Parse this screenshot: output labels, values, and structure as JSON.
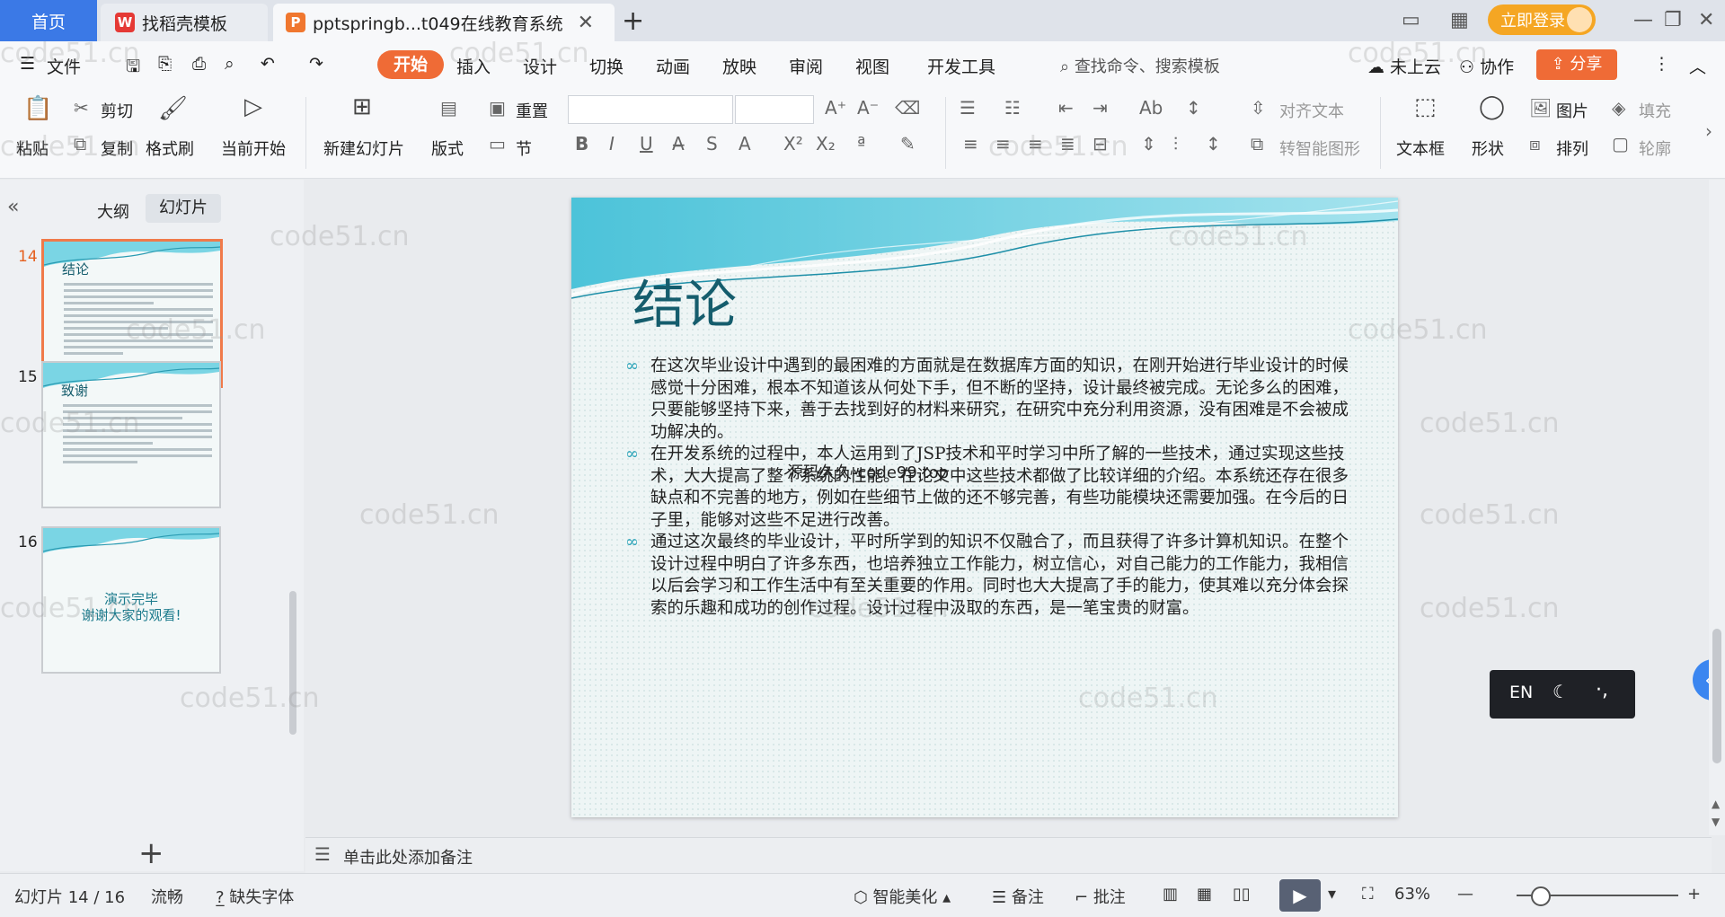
{
  "titlebar": {
    "home_tab": "首页",
    "template_tab": "找稻壳模板",
    "doc_tab": "pptspringb...t049在线教育系统",
    "login_button": "立即登录"
  },
  "menu": {
    "file": "文件",
    "items": [
      "开始",
      "插入",
      "设计",
      "切换",
      "动画",
      "放映",
      "审阅",
      "视图",
      "开发工具"
    ],
    "search": "查找命令、搜索模板",
    "cloud": "未上云",
    "collab": "协作",
    "share": "分享"
  },
  "ribbon": {
    "paste": "粘贴",
    "cut": "剪切",
    "copy": "复制",
    "format_painter": "格式刷",
    "from_current": "当前开始",
    "new_slide": "新建幻灯片",
    "layout": "版式",
    "reset": "重置",
    "section": "节",
    "align_text": "对齐文本",
    "smart_graphic": "转智能图形",
    "textbox": "文本框",
    "shape": "形状",
    "picture": "图片",
    "arrange": "排列",
    "fill": "填充",
    "outline": "轮廓"
  },
  "leftpanel": {
    "outline_tab": "大纲",
    "slides_tab": "幻灯片",
    "thumbs": [
      {
        "num": "14",
        "title": "结论"
      },
      {
        "num": "15",
        "title": "致谢"
      },
      {
        "num": "16",
        "end_line1": "演示完毕",
        "end_line2": "谢谢大家的观看!"
      }
    ]
  },
  "slide": {
    "title": "结论",
    "bullets": [
      "在这次毕业设计中遇到的最困难的方面就是在数据库方面的知识，在刚开始进行毕业设计的时候感觉十分困难，根本不知道该从何处下手，但不断的坚持，设计最终被完成。无论多么的困难，只要能够坚持下来，善于去找到好的材料来研究，在研究中充分利用资源，没有困难是不会被成功解决的。",
      "在开发系统的过程中，本人运用到了JSP技术和平时学习中所了解的一些技术，通过实现这些技术，大大提高了整个系统的性能。在论文中这些技术都做了比较详细的介绍。本系统还存在很多缺点和不完善的地方，例如在些细节上做的还不够完善，有些功能模块还需要加强。在今后的日子里，能够对这些不足进行改善。",
      "通过这次最终的毕业设计，平时所学到的知识不仅融合了，而且获得了许多计算机知识。在整个设计过程中明白了许多东西，也培养独立工作能力，树立信心，对自己能力的工作能力，我相信以后会学习和工作生活中有至关重要的作用。同时也大大提高了手的能力，使其难以充分体会探索的乐趣和成功的创作过程。设计过程中汲取的东西，是一笔宝贵的财富。"
    ],
    "overlay": "源码久久-code99.top"
  },
  "notes_placeholder": "单击此处添加备注",
  "ime": {
    "lang": "EN"
  },
  "statusbar": {
    "slide_info": "幻灯片 14 / 16",
    "theme": "流畅",
    "missing_font": "缺失字体",
    "smart_beautify": "智能美化",
    "notes": "备注",
    "comments": "批注",
    "zoom": "63%"
  },
  "watermark": "code51.cn",
  "colors": {
    "accent": "#ef6b36",
    "home_tab": "#3b79e6",
    "title_teal": "#155d6d"
  }
}
